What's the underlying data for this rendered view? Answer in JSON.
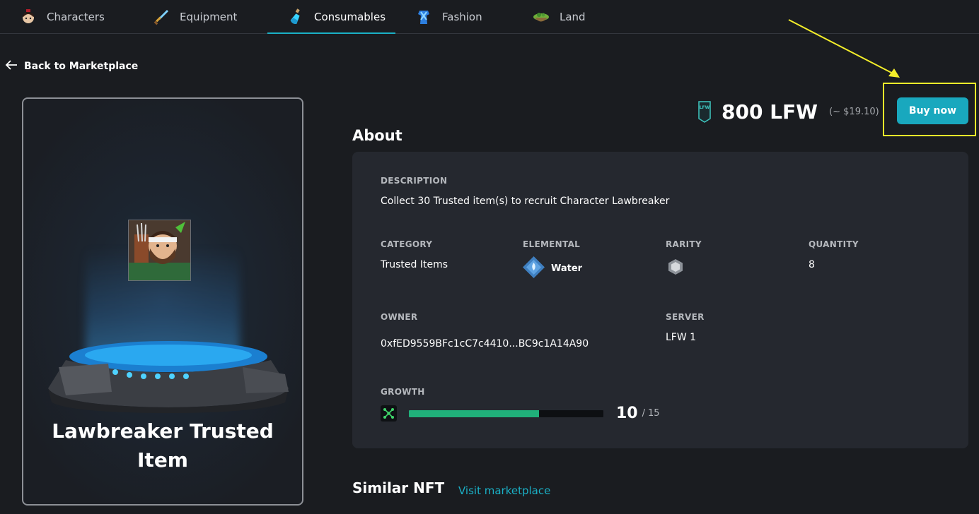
{
  "nav": {
    "tabs": [
      {
        "label": "Characters",
        "icon": "character-avatar-icon"
      },
      {
        "label": "Equipment",
        "icon": "sword-icon"
      },
      {
        "label": "Consumables",
        "icon": "potion-bottle-icon"
      },
      {
        "label": "Fashion",
        "icon": "outfit-icon"
      },
      {
        "label": "Land",
        "icon": "island-icon"
      }
    ],
    "active": "Consumables"
  },
  "back_label": "Back to Marketplace",
  "item": {
    "name": "Lawbreaker Trusted Item",
    "price": "800 LFW",
    "price_usd": "(~ $19.10)",
    "token_logo_text": "LFW"
  },
  "buy_label": "Buy now",
  "about": {
    "title": "About",
    "description_label": "DESCRIPTION",
    "description": "Collect 30 Trusted item(s) to recruit Character Lawbreaker",
    "category_label": "CATEGORY",
    "category": "Trusted Items",
    "elemental_label": "ELEMENTAL",
    "elemental": "Water",
    "rarity_label": "RARITY",
    "quantity_label": "QUANTITY",
    "quantity": "8",
    "owner_label": "OWNER",
    "owner": "0xfED9559BFc1cC7c4410...BC9c1A14A90",
    "server_label": "SERVER",
    "server": "LFW 1",
    "growth_label": "GROWTH",
    "growth_value": "10",
    "growth_sep": "/",
    "growth_max": "15",
    "growth_fraction": 0.67
  },
  "similar": {
    "title": "Similar NFT",
    "link": "Visit marketplace"
  },
  "colors": {
    "accent": "#1ab0c6",
    "growth_bar": "#20b07a",
    "highlight": "#f4ee2a",
    "background": "#1a1c20",
    "panel": "#25282f"
  }
}
